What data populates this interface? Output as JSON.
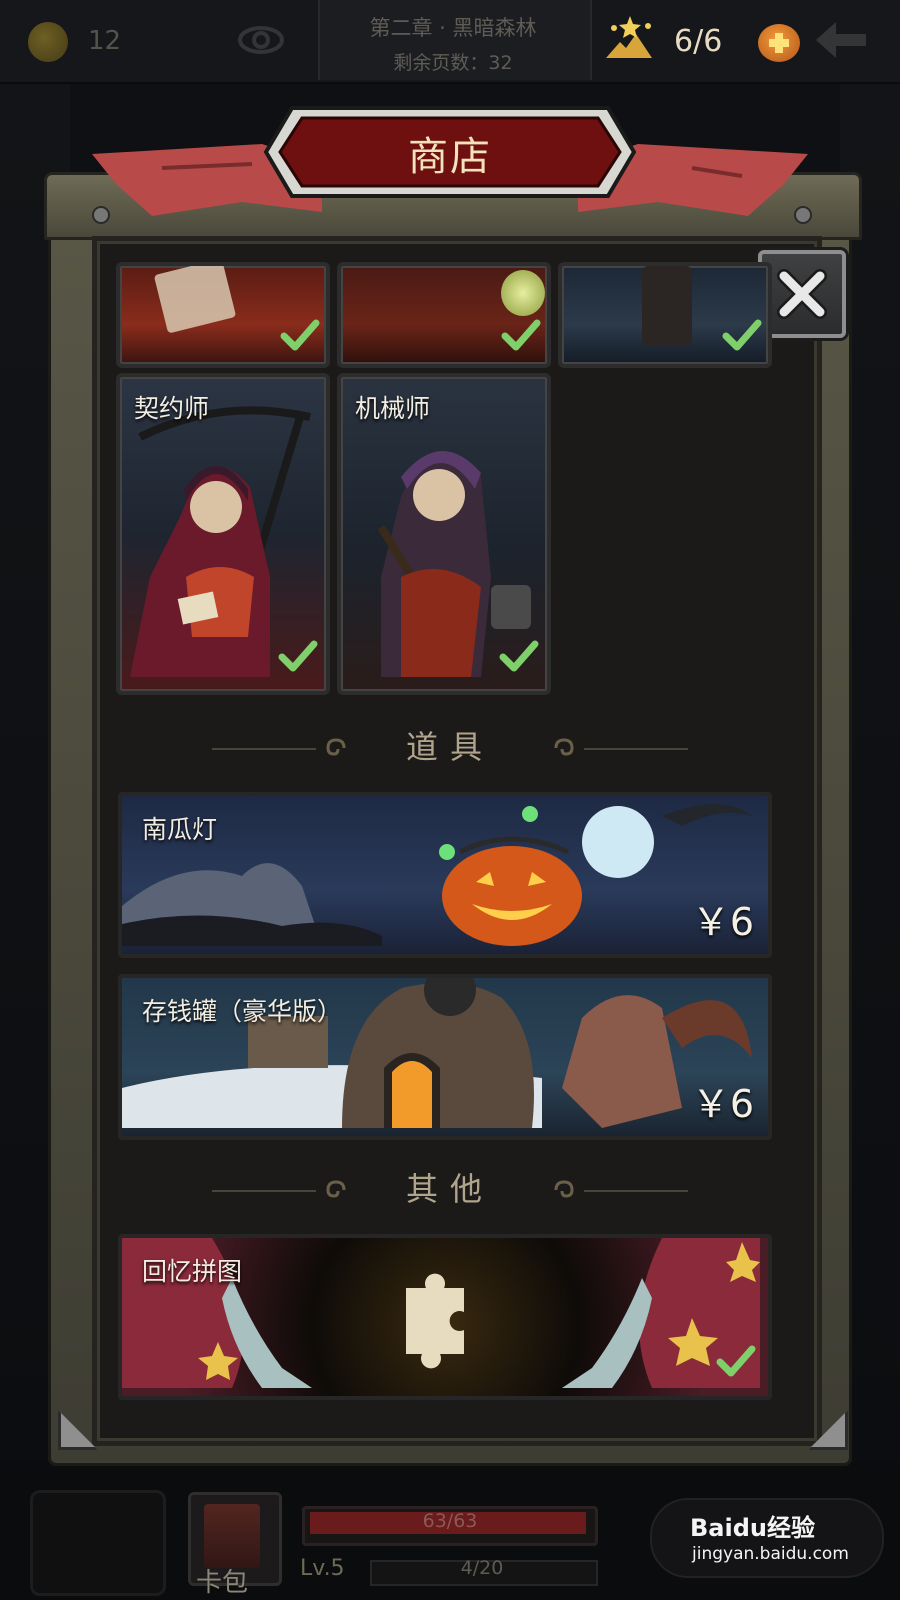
{
  "hud": {
    "coins": "12",
    "chapter": "第二章 · 黑暗森林",
    "pages_left": "剩余页数：32",
    "energy": "6/6"
  },
  "shop": {
    "title": "商店",
    "heroes_top": [
      {
        "label": "",
        "owned": true
      },
      {
        "label": "",
        "owned": true
      },
      {
        "label": "",
        "owned": true
      }
    ],
    "heroes": [
      {
        "label": "契约师",
        "owned": true
      },
      {
        "label": "机械师",
        "owned": true
      }
    ],
    "sections": {
      "items": "道具",
      "other": "其他"
    },
    "items": [
      {
        "label": "南瓜灯",
        "price": "￥6"
      },
      {
        "label": "存钱罐（豪华版）",
        "price": "￥6"
      }
    ],
    "other": [
      {
        "label": "回忆拼图",
        "owned": true
      }
    ]
  },
  "bottom": {
    "deck_label": "卡包",
    "hp": "63/63",
    "level": "Lv.5",
    "xp": "4/20"
  },
  "watermark": {
    "brand": "Baidu经验",
    "url": "jingyan.baidu.com"
  },
  "colors": {
    "accent_red": "#7a1414",
    "check_green": "#7fcf6a",
    "frame_metal": "#595746"
  }
}
